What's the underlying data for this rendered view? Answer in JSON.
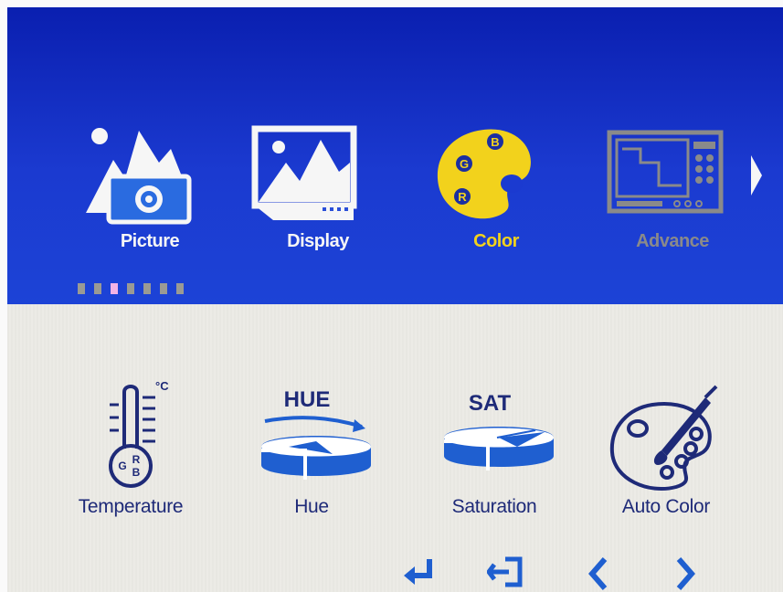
{
  "menu": {
    "tabs": [
      {
        "label": "Picture",
        "icon": "picture-icon",
        "state": "normal"
      },
      {
        "label": "Display",
        "icon": "display-icon",
        "state": "normal"
      },
      {
        "label": "Color",
        "icon": "color-palette-icon",
        "state": "active"
      },
      {
        "label": "Advance",
        "icon": "advance-icon",
        "state": "disabled"
      }
    ],
    "page_indicator": {
      "count": 7,
      "current": 3
    },
    "palette_letters": {
      "b": "B",
      "g": "G",
      "r": "R"
    }
  },
  "color_items": [
    {
      "label": "Temperature",
      "icon": "thermometer-icon",
      "unit": "°C",
      "badge_g": "G",
      "badge_r": "R",
      "badge_b": "B"
    },
    {
      "label": "Hue",
      "icon": "hue-icon",
      "caption": "HUE"
    },
    {
      "label": "Saturation",
      "icon": "saturation-icon",
      "caption": "SAT"
    },
    {
      "label": "Auto Color",
      "icon": "auto-color-palette-icon"
    }
  ],
  "nav_buttons": [
    {
      "icon": "enter-icon"
    },
    {
      "icon": "exit-icon"
    },
    {
      "icon": "chevron-left-icon"
    },
    {
      "icon": "chevron-right-icon"
    }
  ],
  "colors": {
    "top_bg": "#1b3ad0",
    "bottom_bg": "#ecebe6",
    "active": "#f2d21c",
    "inactive_label": "#f6f6f6",
    "disabled": "#8a8a8a",
    "item_ink": "#1e2a78",
    "icon_blue": "#1f5fd0"
  }
}
